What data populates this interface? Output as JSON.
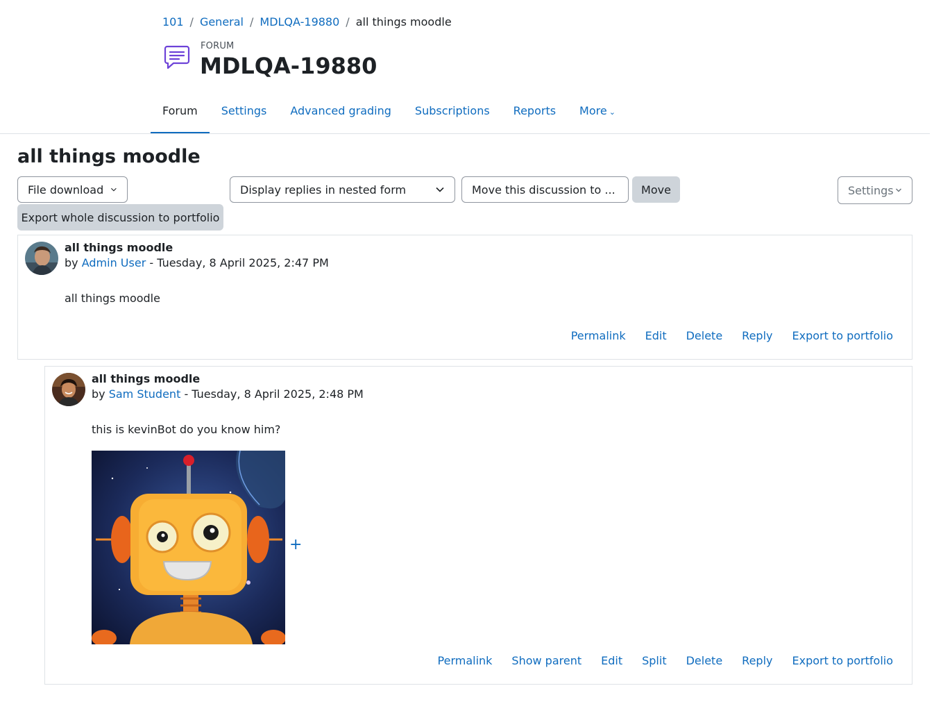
{
  "breadcrumb": [
    {
      "label": "101"
    },
    {
      "label": "General"
    },
    {
      "label": "MDLQA-19880"
    },
    {
      "label": "all things moodle"
    }
  ],
  "header": {
    "module_type": "FORUM",
    "title": "MDLQA-19880",
    "icon": "forum-icon"
  },
  "nav": {
    "tabs": [
      "Forum",
      "Settings",
      "Advanced grading",
      "Subscriptions",
      "Reports",
      "More"
    ],
    "active": "Forum"
  },
  "discussion": {
    "title": "all things moodle",
    "file_download": "File download",
    "display_mode": "Display replies in nested form",
    "move_to": "Move this discussion to ...",
    "move_button": "Move",
    "settings_button": "Settings",
    "export_button": "Export whole discussion to portfolio"
  },
  "posts": [
    {
      "subject": "all things moodle",
      "by": "by",
      "author": "Admin User",
      "date": "- Tuesday, 8 April 2025, 2:47 PM",
      "body": "all things moodle",
      "actions": [
        "Permalink",
        "Edit",
        "Delete",
        "Reply",
        "Export to portfolio"
      ]
    },
    {
      "subject": "all things moodle",
      "by": "by",
      "author": "Sam Student",
      "date": "- Tuesday, 8 April 2025, 2:48 PM",
      "body": "this is kevinBot do you know him?",
      "image_plus": "+",
      "actions": [
        "Permalink",
        "Show parent",
        "Edit",
        "Split",
        "Delete",
        "Reply",
        "Export to portfolio"
      ]
    }
  ],
  "colors": {
    "link": "#0f6cbf",
    "text": "#1d2125",
    "border": "#dee2e6",
    "button_grey": "#ced4da",
    "forum_icon": "#6d42d8"
  }
}
